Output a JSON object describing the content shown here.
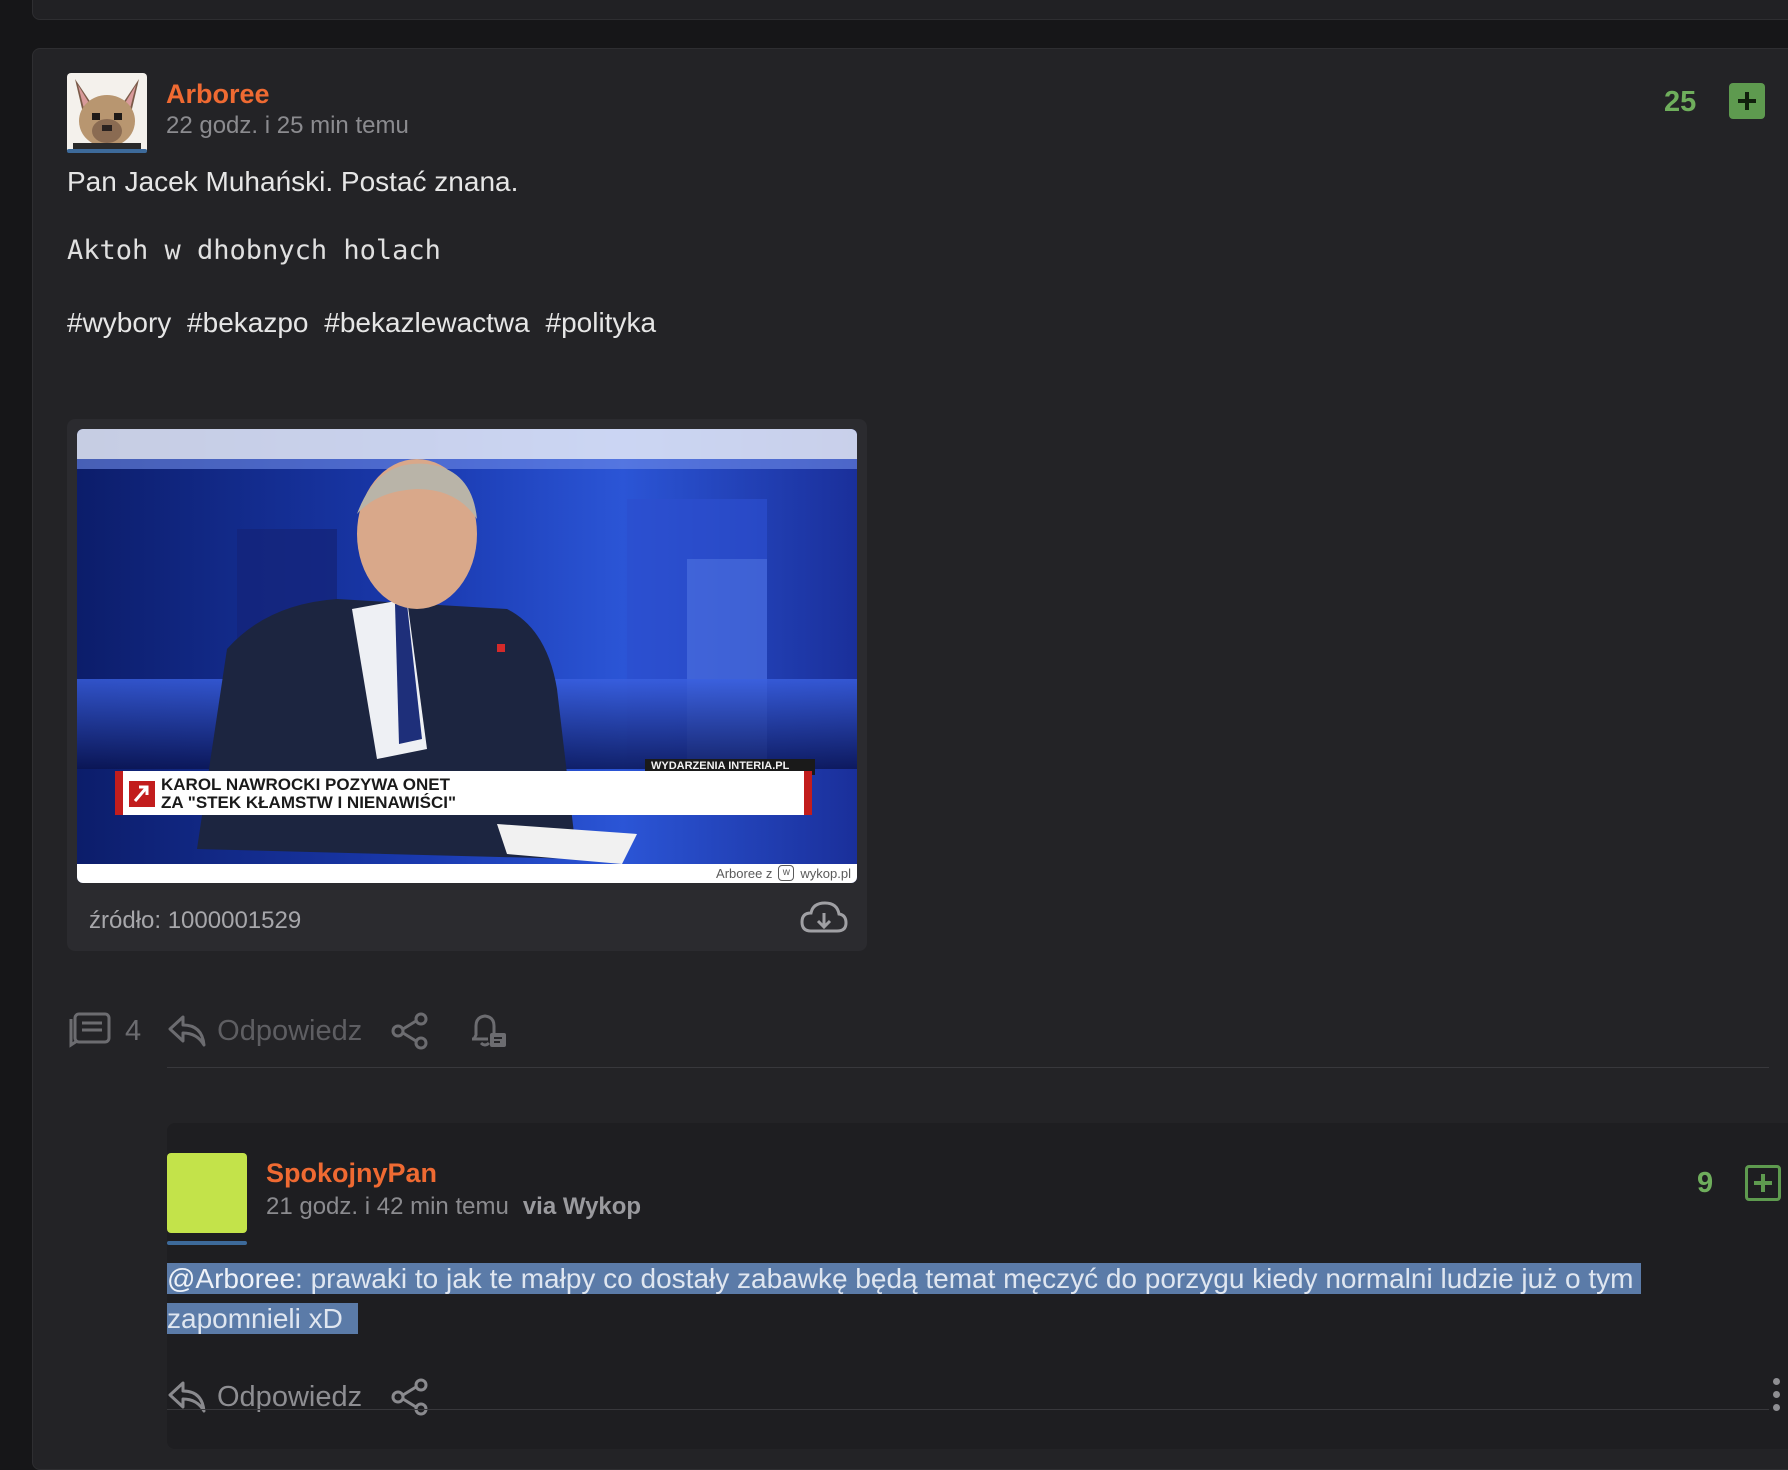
{
  "post": {
    "author": "Arboree",
    "time": "22 godz. i 25 min temu",
    "votes": "25",
    "line1": "Pan Jacek Muhański. Postać znana.",
    "code_line": "Aktoh w dhobnych holach",
    "tags": [
      "#wybory",
      "#bekazpo",
      "#bekazlewactwa",
      "#polityka"
    ],
    "media": {
      "caption_line1": "KAROL NAWROCKI POZYWA ONET",
      "caption_line2": "ZA \"STEK KŁAMSTW I NIENAWIŚCI\"",
      "channel_tag": "WYDARZENIA INTERIA.PL",
      "watermark_user": "Arboree z",
      "watermark_site": "wykop.pl",
      "source": "źródło: 1000001529"
    },
    "comments_count": "4",
    "reply_label": "Odpowiedz"
  },
  "reply": {
    "author": "SpokojnyPan",
    "time": "21 godz. i 42 min temu",
    "via": "via Wykop",
    "votes": "9",
    "mention": "@Arboree",
    "text_line1": ": prawaki to jak te małpy co dostały zabawkę będą temat męczyć do porzygu kiedy normalni ludzie już o tym",
    "text_line2": "zapomnieli xD",
    "reply_label": "Odpowiedz",
    "avatar_color": "#c3e34a"
  },
  "colors": {
    "username": "#ef6a32",
    "vote_green": "#5e9a4f",
    "selection": "#5b7ba8"
  },
  "icons": [
    "comments-icon",
    "reply-arrow-icon",
    "share-icon",
    "bell-icon",
    "download-cloud-icon",
    "plus-icon",
    "kebab-menu-icon"
  ]
}
